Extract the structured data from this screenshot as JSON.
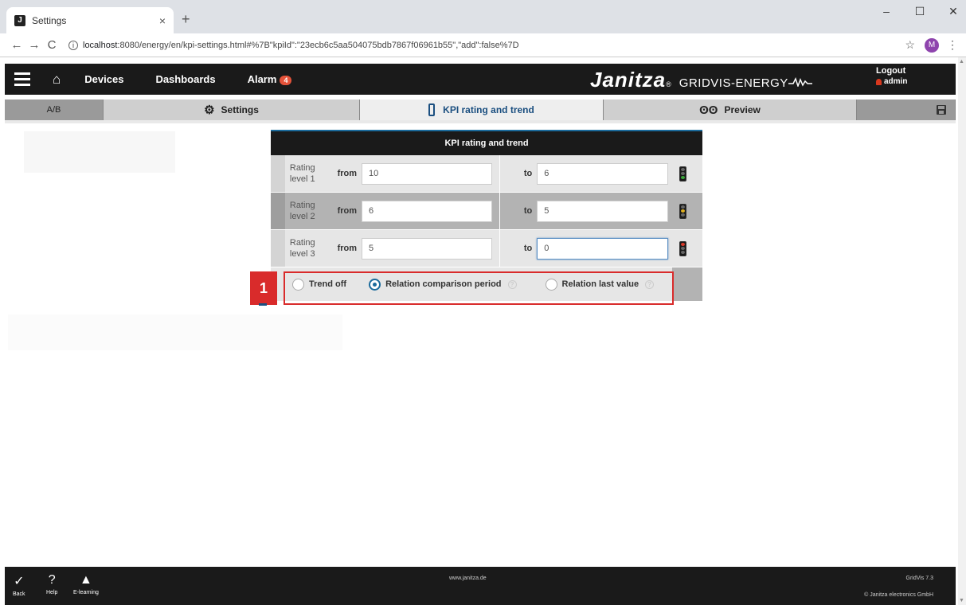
{
  "browser": {
    "tab_title": "Settings",
    "tab_close": "×",
    "new_tab": "+",
    "url_host": "localhost",
    "url_rest": ":8080/energy/en/kpi-settings.html#%7B\"kpiId\":\"23ecb6c5aa504075bdb7867f06961b55\",\"add\":false%7D",
    "profile_initial": "M",
    "window_controls": [
      "–",
      "☐",
      "✕"
    ]
  },
  "header": {
    "nav": [
      "Devices",
      "Dashboards",
      "Alarm"
    ],
    "alarm_count": "4",
    "brand": "Janitza",
    "brand_reg": "®",
    "brand_sub": "GRIDVIS-ENERGY",
    "logout": "Logout",
    "user": "admin"
  },
  "sub_nav": {
    "ab": "A/B",
    "settings": "Settings",
    "kpi": "KPI rating and trend",
    "preview": "Preview"
  },
  "panel": {
    "title": "KPI rating and trend",
    "from_label": "from",
    "to_label": "to",
    "rows": [
      {
        "label_line1": "Rating",
        "label_line2": "level 1",
        "from": "10",
        "to": "6",
        "light": "green"
      },
      {
        "label_line1": "Rating",
        "label_line2": "level 2",
        "from": "6",
        "to": "5",
        "light": "yellow"
      },
      {
        "label_line1": "Rating",
        "label_line2": "level 3",
        "from": "5",
        "to": "0",
        "light": "red"
      }
    ],
    "trend_options": [
      "Trend off",
      "Relation comparison period",
      "Relation last value"
    ],
    "trend_selected": "Relation comparison period",
    "help_glyph": "?"
  },
  "annotation": {
    "step_number": "1"
  },
  "footer": {
    "back": "Back",
    "help": "Help",
    "elearning": "E-learning",
    "url": "www.janitza.de",
    "version": "GridVis 7.3",
    "copyright": "© Janitza electronics GmbH"
  },
  "colors": {
    "dark_bar": "#1a1a1a",
    "accent_blue": "#1b4f80",
    "annotation_red": "#d92b2b",
    "light_green": "#3aa63a",
    "light_yellow": "#e0b020",
    "light_red": "#d83a2a"
  }
}
